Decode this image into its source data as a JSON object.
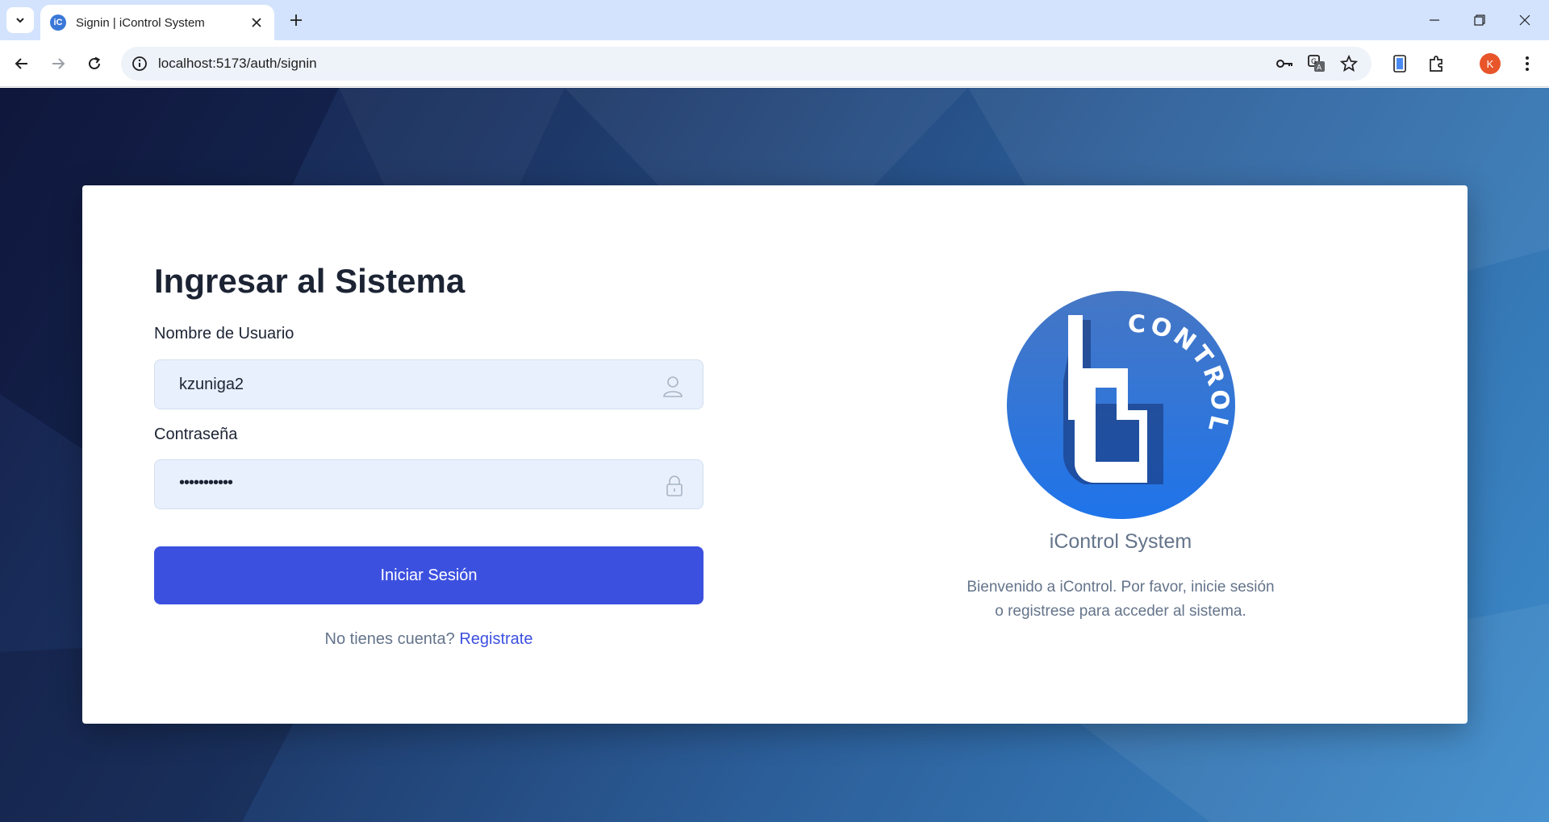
{
  "browser": {
    "tab_title": "Signin | iControl System",
    "favicon_text": "iC",
    "url": "localhost:5173/auth/signin",
    "profile_initial": "K"
  },
  "form": {
    "heading": "Ingresar al Sistema",
    "username_label": "Nombre de Usuario",
    "username_value": "kzuniga2",
    "password_label": "Contraseña",
    "password_value": "•••••••••••",
    "submit_label": "Iniciar Sesión",
    "no_account_text": "No tienes cuenta?",
    "signup_link": "Registrate"
  },
  "branding": {
    "logo_text": "CONTROL",
    "app_name": "iControl System",
    "welcome_line1": "Bienvenido a iControl. Por favor, inicie sesión",
    "welcome_line2": "o registrese para acceder al sistema."
  },
  "colors": {
    "primary": "#3c50e0",
    "heading": "#1c2434",
    "muted": "#64748b",
    "input_bg": "#e8f0fe",
    "logo_blue": "#2a7de1"
  }
}
